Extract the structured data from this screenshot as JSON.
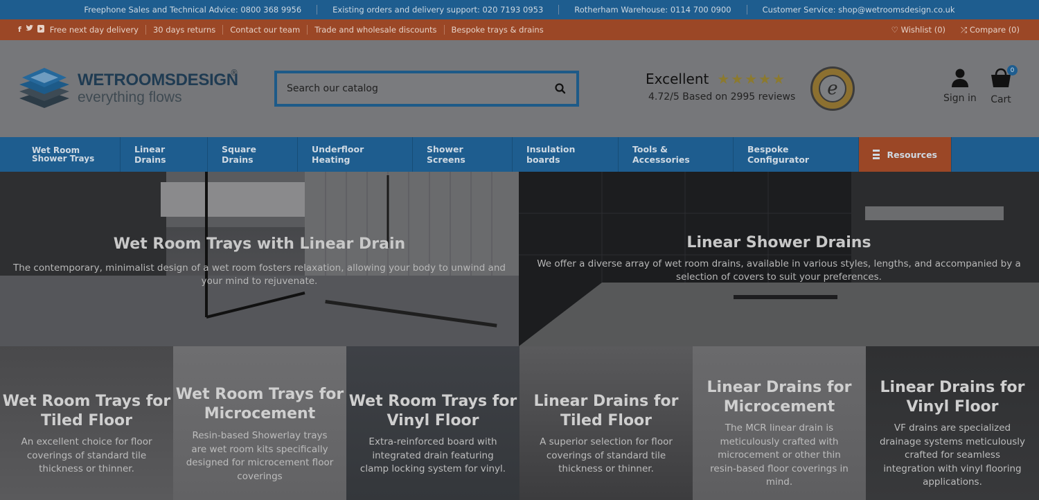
{
  "topbar": {
    "items": [
      "Freephone Sales and Technical Advice: 0800 368 9956",
      "Existing orders and delivery support: 020 7193 0953",
      "Rotherham Warehouse: 0114 700 0900",
      "Customer Service: shop@wetroomsdesign.co.uk"
    ]
  },
  "promobar": {
    "social": [
      "f",
      "t",
      "yt"
    ],
    "links": [
      "Free next day delivery",
      "30 days returns",
      "Contact our team",
      "Trade and wholesale discounts",
      "Bespoke trays & drains"
    ],
    "wishlist": "Wishlist (0)",
    "compare": "Compare (0)"
  },
  "header": {
    "logo_main": "WETROOMSDESIGN",
    "logo_sub": "everything flows",
    "logo_reg": "®",
    "search_placeholder": "Search our catalog",
    "rating_word": "Excellent",
    "stars": "★★★★★",
    "rating_text": "4.72/5 Based on 2995 reviews",
    "badge_letter": "e",
    "sign_in": "Sign in",
    "cart": "Cart",
    "cart_count": "0"
  },
  "nav": {
    "first_line1": "Wet Room",
    "first_line2": "Shower Trays",
    "items": [
      "Linear Drains",
      "Square Drains",
      "Underfloor Heating",
      "Shower Screens",
      "Insulation boards",
      "Tools & Accessories",
      "Bespoke Configurator"
    ],
    "resources": "Resources"
  },
  "hero": {
    "left_title": "Wet Room Trays with Linear Drain",
    "left_text": "The contemporary, minimalist design of a wet room fosters relaxation, allowing your body to unwind and your mind to rejuvenate.",
    "right_title": "Linear Shower Drains",
    "right_text": "We offer a diverse array of wet room drains, available in various styles, lengths, and accompanied by a selection of covers to suit your preferences."
  },
  "cards": [
    {
      "title": "Wet Room Trays for Tiled Floor",
      "text": "An excellent choice for floor coverings of standard tile thickness or thinner."
    },
    {
      "title": "Wet Room Trays for Microcement",
      "text": "Resin-based Showerlay trays are wet room kits specifically designed for microcement floor coverings"
    },
    {
      "title": "Wet Room Trays for Vinyl Floor",
      "text": "Extra-reinforced board with integrated drain featuring clamp locking system for vinyl."
    },
    {
      "title": "Linear Drains for Tiled Floor",
      "text": "A superior selection for floor coverings of standard tile thickness or thinner."
    },
    {
      "title": "Linear Drains for Microcement",
      "text": "The MCR linear drain is meticulously crafted with microcement or other thin resin-based floor coverings in mind."
    },
    {
      "title": "Linear Drains for Vinyl Floor",
      "text": "VF drains are specialized drainage systems meticulously crafted for seamless integration with vinyl flooring applications."
    }
  ]
}
